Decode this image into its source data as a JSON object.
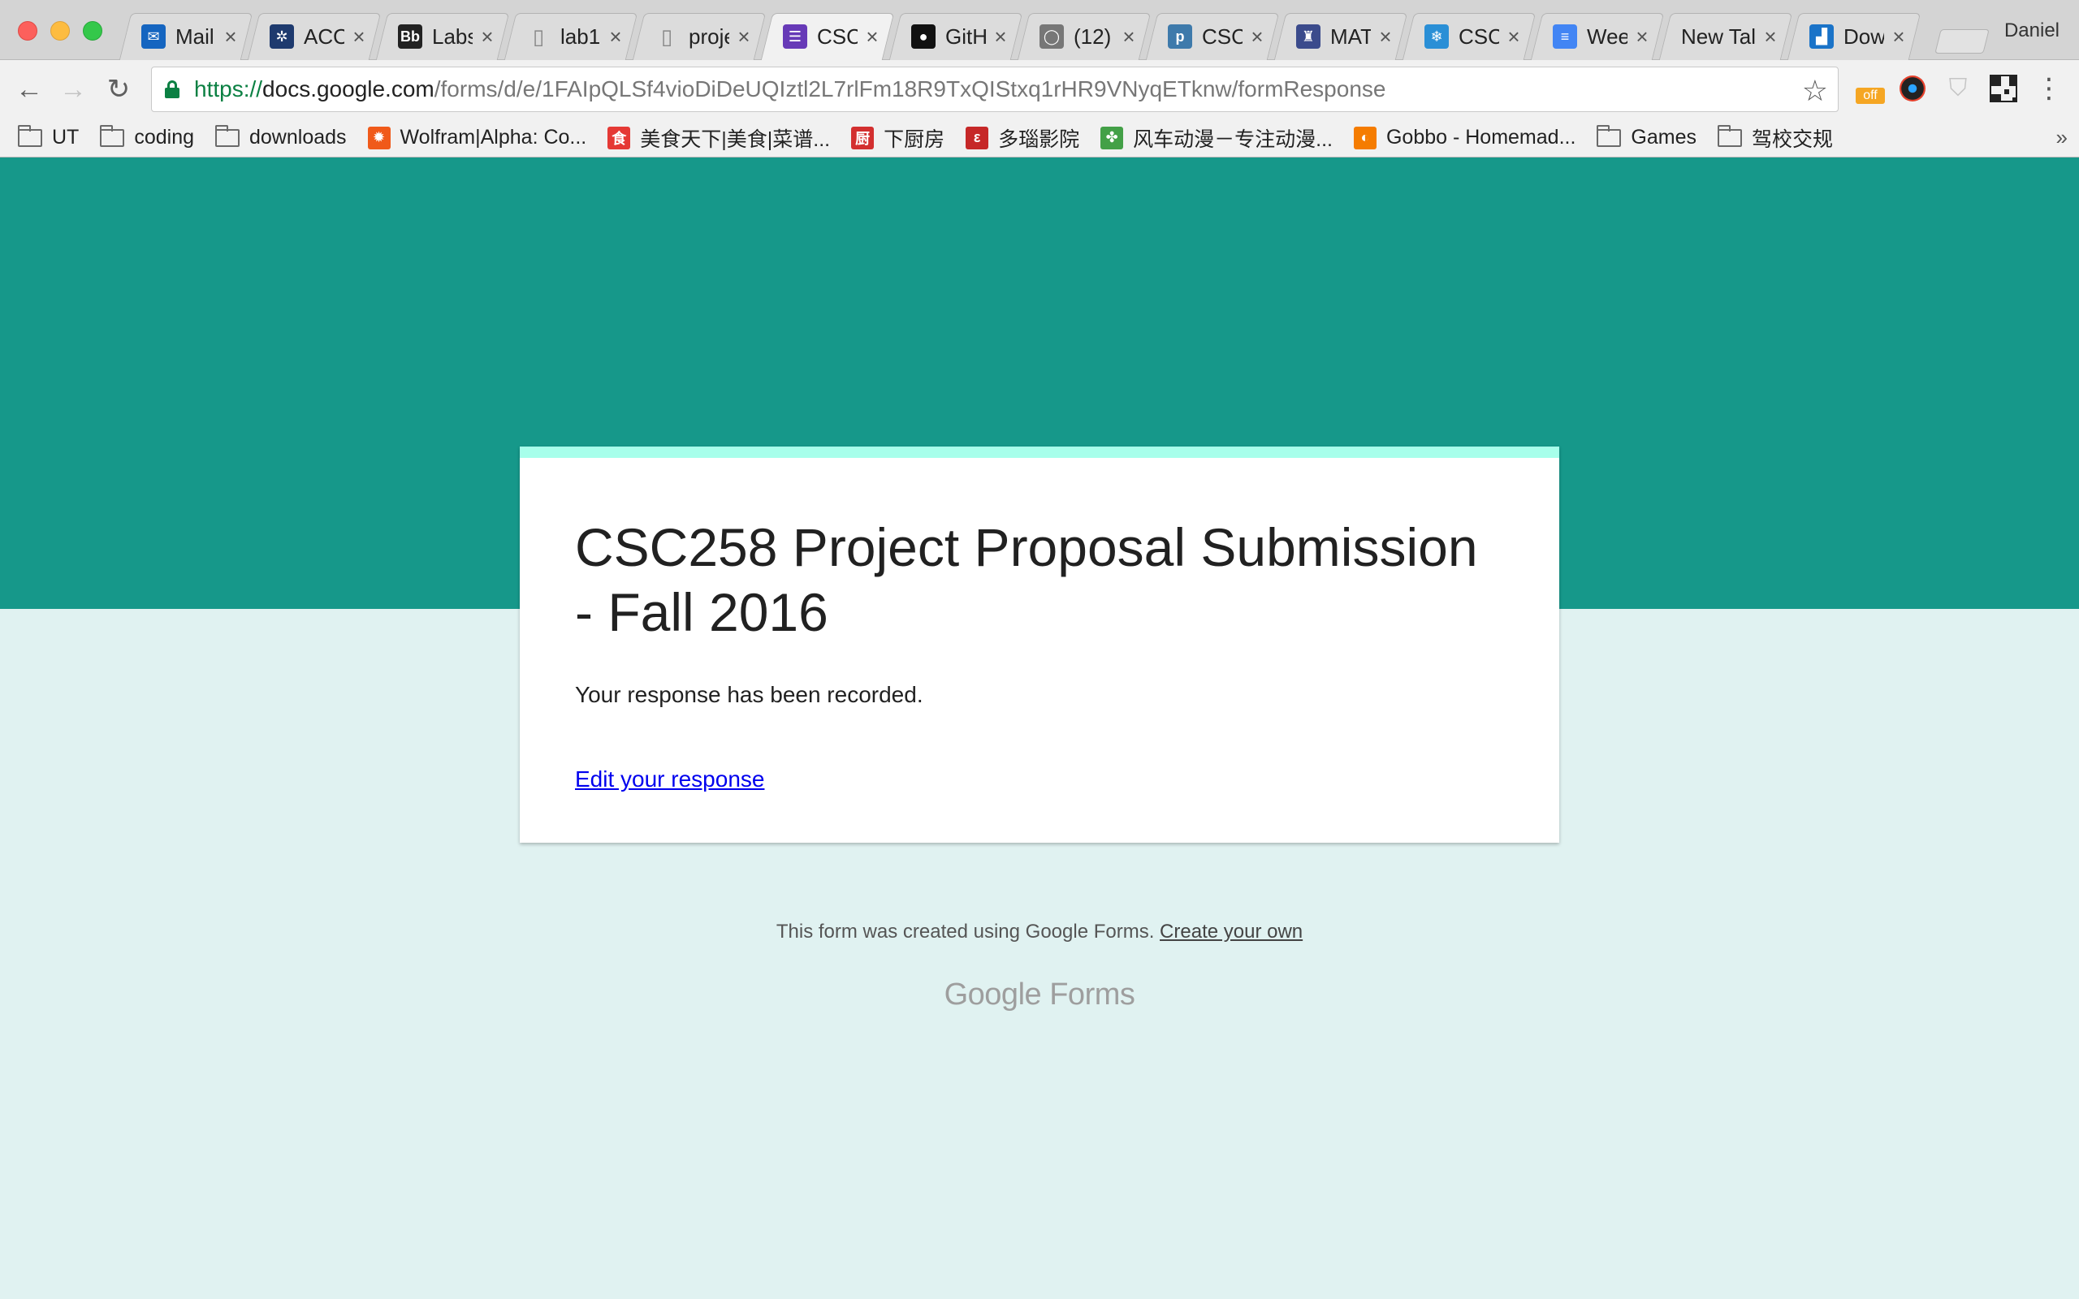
{
  "browser": {
    "profile_name": "Daniel",
    "tabs": [
      {
        "title": "Mail",
        "icon": "mail-icon",
        "icon_color": "#1565c0",
        "active": false
      },
      {
        "title": "ACO",
        "icon": "tree-logo-icon",
        "icon_color": "#1e3a6e",
        "active": false
      },
      {
        "title": "Labs",
        "icon": "blackboard-icon",
        "icon_color": "#222222",
        "active": false
      },
      {
        "title": "lab1",
        "icon": "document-icon",
        "icon_color": "#888888",
        "active": false
      },
      {
        "title": "proje",
        "icon": "document-icon",
        "icon_color": "#888888",
        "active": false
      },
      {
        "title": "CSC",
        "icon": "google-forms-icon",
        "icon_color": "#673ab7",
        "active": true
      },
      {
        "title": "GitH",
        "icon": "github-icon",
        "icon_color": "#111111",
        "active": false
      },
      {
        "title": "(12)",
        "icon": "chat-icon",
        "icon_color": "#777777",
        "active": false
      },
      {
        "title": "CSC",
        "icon": "piazza-icon",
        "icon_color": "#3e7aab",
        "active": false
      },
      {
        "title": "MAT",
        "icon": "crest-icon",
        "icon_color": "#3b4b8c",
        "active": false
      },
      {
        "title": "CSC",
        "icon": "snowflake-icon",
        "icon_color": "#2a8fd6",
        "active": false
      },
      {
        "title": "Wee",
        "icon": "google-docs-icon",
        "icon_color": "#4285f4",
        "active": false
      },
      {
        "title": "New Tal",
        "icon": "",
        "icon_color": "",
        "active": false
      },
      {
        "title": "Dowi",
        "icon": "chart-icon",
        "icon_color": "#1a73c8",
        "active": false
      }
    ],
    "url": {
      "scheme": "https://",
      "host": "docs.google.com",
      "path": "/forms/d/e/1FAIpQLSf4vioDiDeUQIztl2L7rlFm18R9TxQIStxq1rHR9VNyqETknw/formResponse"
    },
    "extensions": {
      "off_badge": "off"
    },
    "bookmarks": [
      {
        "label": "UT",
        "icon": "folder-icon",
        "icon_color": ""
      },
      {
        "label": "coding",
        "icon": "folder-icon",
        "icon_color": ""
      },
      {
        "label": "downloads",
        "icon": "folder-icon",
        "icon_color": ""
      },
      {
        "label": "Wolfram|Alpha: Co...",
        "icon": "wolfram-icon",
        "icon_color": "#f05a1a"
      },
      {
        "label": "美食天下|美食|菜谱...",
        "icon": "meishi-icon",
        "icon_color": "#e53935"
      },
      {
        "label": "下厨房",
        "icon": "xiachufang-icon",
        "icon_color": "#d32f2f"
      },
      {
        "label": "多瑙影院",
        "icon": "duonao-icon",
        "icon_color": "#c62828"
      },
      {
        "label": "风车动漫－专注动漫...",
        "icon": "pinwheel-icon",
        "icon_color": "#43a047"
      },
      {
        "label": "Gobbo - Homemad...",
        "icon": "gobbo-icon",
        "icon_color": "#f57c00"
      },
      {
        "label": "Games",
        "icon": "folder-icon",
        "icon_color": ""
      },
      {
        "label": "驾校交规",
        "icon": "folder-icon",
        "icon_color": ""
      }
    ]
  },
  "form": {
    "title": "CSC258 Project Proposal Submission - Fall 2016",
    "confirmation_message": "Your response has been recorded.",
    "edit_link": "Edit your response",
    "header_color": "#16988a",
    "accent_color": "#a7ffeb",
    "background_color": "#e0f2f1"
  },
  "footer": {
    "note": "This form was created using Google Forms.",
    "create_link": "Create your own",
    "logo_google": "Google",
    "logo_forms": "Forms"
  }
}
